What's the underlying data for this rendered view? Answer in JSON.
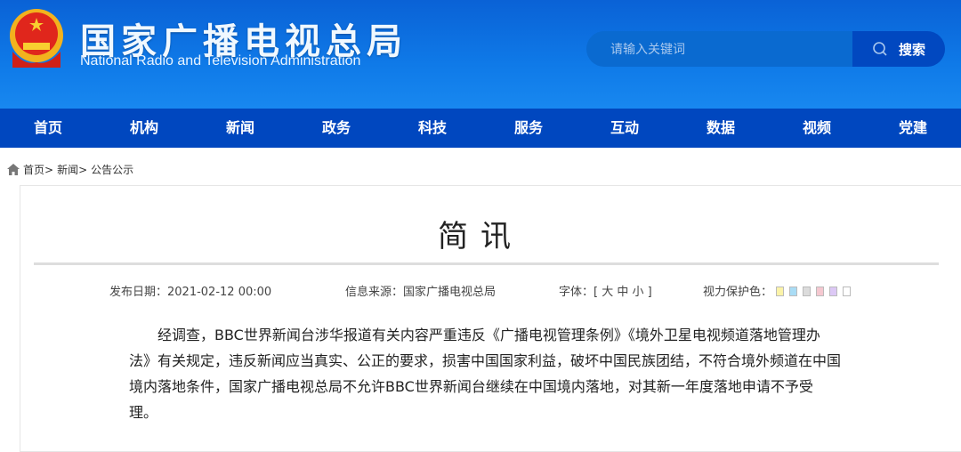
{
  "header": {
    "title_cn": "国家广播电视总局",
    "title_en": "National Radio and Television Administration",
    "search_placeholder": "请输入关键词",
    "search_button": "搜索"
  },
  "nav": [
    "首页",
    "机构",
    "新闻",
    "政务",
    "科技",
    "服务",
    "互动",
    "数据",
    "视频",
    "党建"
  ],
  "breadcrumb": [
    "首页>",
    "新闻>",
    "公告公示"
  ],
  "article": {
    "title": "简讯",
    "date_label": "发布日期：",
    "date": "2021-02-12 00:00",
    "source_label": "信息来源：",
    "source": "国家广播电视总局",
    "font_label": "字体：",
    "font_sizes": "[ 大 中 小 ]",
    "eye_label": "视力保护色：",
    "eye_colors": [
      "#fbf3a8",
      "#a9dcf5",
      "#dcdcdc",
      "#f5c8d0",
      "#dcc8f5",
      "#ffffff"
    ],
    "body": "经调查，BBC世界新闻台涉华报道有关内容严重违反《广播电视管理条例》《境外卫星电视频道落地管理办法》有关规定，违反新闻应当真实、公正的要求，损害中国国家利益，破坏中国民族团结，不符合境外频道在中国境内落地条件，国家广播电视总局不允许BBC世界新闻台继续在中国境内落地，对其新一年度落地申请不予受理。"
  }
}
